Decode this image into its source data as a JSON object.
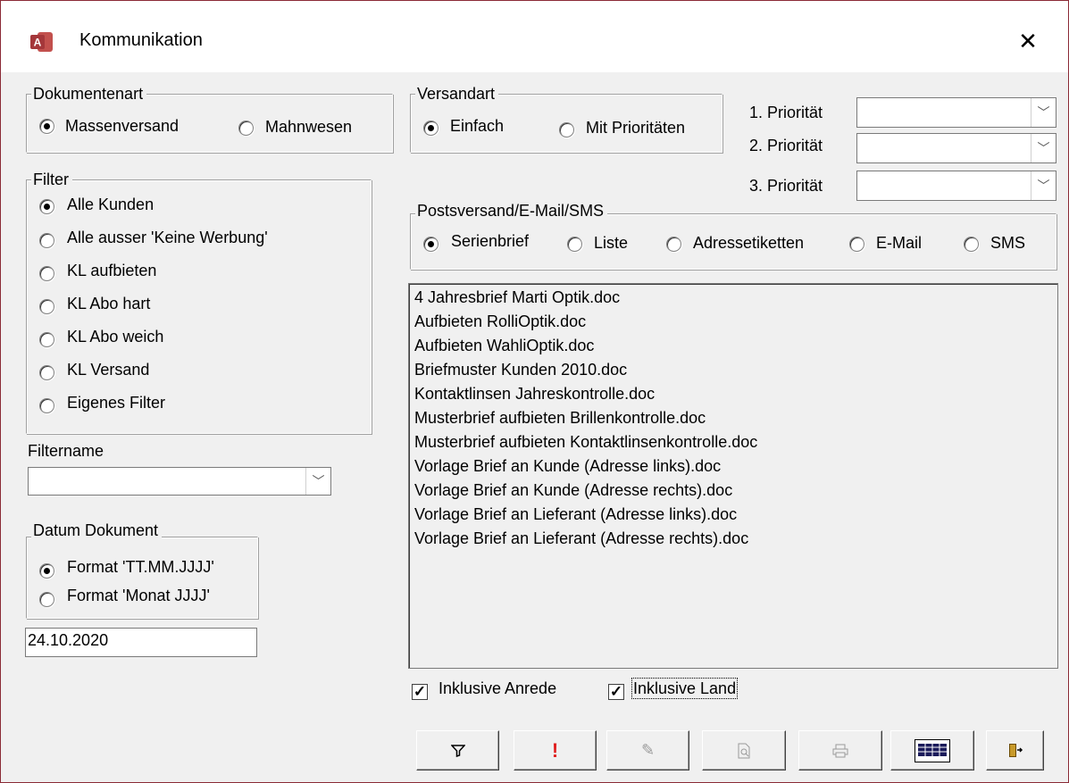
{
  "window": {
    "title": "Kommunikation",
    "icon": "access-app-icon",
    "close_label": "✕"
  },
  "dokumentenart": {
    "legend": "Dokumentenart",
    "options": [
      {
        "label": "Massenversand",
        "selected": true
      },
      {
        "label": "Mahnwesen",
        "selected": false
      }
    ]
  },
  "filter": {
    "legend": "Filter",
    "options": [
      {
        "label": "Alle Kunden",
        "selected": true
      },
      {
        "label": "Alle ausser 'Keine Werbung'",
        "selected": false
      },
      {
        "label": "KL aufbieten",
        "selected": false
      },
      {
        "label": "KL Abo hart",
        "selected": false
      },
      {
        "label": "KL Abo weich",
        "selected": false
      },
      {
        "label": "KL Versand",
        "selected": false
      },
      {
        "label": "Eigenes Filter",
        "selected": false
      }
    ]
  },
  "filtername": {
    "label": "Filtername",
    "value": ""
  },
  "datum": {
    "legend": "Datum Dokument",
    "options": [
      {
        "label": "Format 'TT.MM.JJJJ'",
        "selected": true
      },
      {
        "label": "Format 'Monat JJJJ'",
        "selected": false
      }
    ],
    "value": "24.10.2020"
  },
  "versandart": {
    "legend": "Versandart",
    "options": [
      {
        "label": "Einfach",
        "selected": true
      },
      {
        "label": "Mit Prioritäten",
        "selected": false
      }
    ]
  },
  "prioritaeten": [
    {
      "label": "1. Priorität",
      "value": ""
    },
    {
      "label": "2. Priorität",
      "value": ""
    },
    {
      "label": "3. Priorität",
      "value": ""
    }
  ],
  "postversand": {
    "legend": "Postsversand/E-Mail/SMS",
    "options": [
      {
        "label": "Serienbrief",
        "selected": true
      },
      {
        "label": "Liste",
        "selected": false
      },
      {
        "label": "Adressetiketten",
        "selected": false
      },
      {
        "label": "E-Mail",
        "selected": false
      },
      {
        "label": "SMS",
        "selected": false
      }
    ]
  },
  "documents": [
    "4 Jahresbrief Marti Optik.doc",
    "Aufbieten RolliOptik.doc",
    "Aufbieten WahliOptik.doc",
    "Briefmuster Kunden 2010.doc",
    "Kontaktlinsen Jahreskontrolle.doc",
    "Musterbrief aufbieten Brillenkontrolle.doc",
    "Musterbrief aufbieten Kontaktlinsenkontrolle.doc",
    "Vorlage Brief an Kunde (Adresse links).doc",
    "Vorlage Brief an Kunde (Adresse rechts).doc",
    "Vorlage Brief an Lieferant (Adresse links).doc",
    "Vorlage Brief an Lieferant (Adresse rechts).doc"
  ],
  "checkboxes": {
    "anrede": {
      "label": "Inklusive Anrede",
      "checked": true
    },
    "land": {
      "label": "Inklusive Land",
      "checked": true
    }
  },
  "toolbar": [
    {
      "icon": "filter-icon",
      "glyph": "▽",
      "enabled": true
    },
    {
      "icon": "exclamation-icon",
      "glyph": "!",
      "enabled": true
    },
    {
      "icon": "pencil-icon",
      "glyph": "✎",
      "enabled": false
    },
    {
      "icon": "preview-icon",
      "glyph": "🗋",
      "enabled": false
    },
    {
      "icon": "printer-icon",
      "glyph": "⎙",
      "enabled": false
    },
    {
      "icon": "table-icon",
      "glyph": "▦",
      "enabled": true
    },
    {
      "icon": "exit-door-icon",
      "glyph": "⇥",
      "enabled": true
    }
  ],
  "colors": {
    "title_border": "#8b2a36",
    "access_red": "#a4373a",
    "exclamation": "#e02020"
  }
}
